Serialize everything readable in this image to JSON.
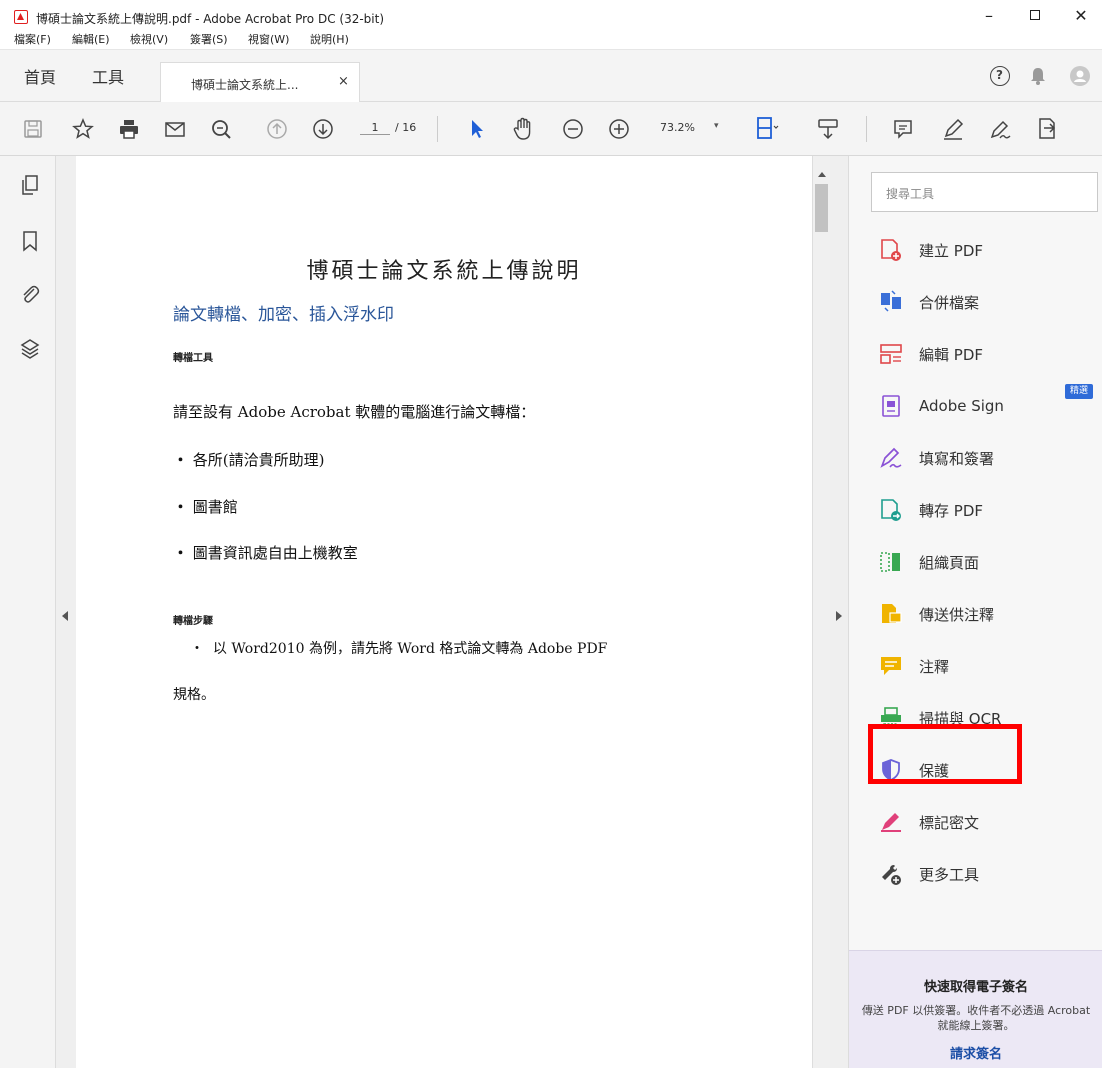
{
  "window": {
    "title": "博碩士論文系統上傳說明.pdf - Adobe Acrobat Pro DC (32-bit)",
    "minimize": "–",
    "close": "✕"
  },
  "menu": [
    "檔案(F)",
    "編輯(E)",
    "檢視(V)",
    "簽署(S)",
    "視窗(W)",
    "說明(H)"
  ],
  "tabs": {
    "home": "首頁",
    "tools": "工具",
    "document": "博碩士論文系統上...",
    "close": "×"
  },
  "toolbar": {
    "page_current": "1",
    "page_total": "/ 16",
    "zoom": "73.2%",
    "zoom_arrow": "▾"
  },
  "document": {
    "title": "博碩士論文系統上傳說明",
    "heading": "論文轉檔、加密、插入浮水印",
    "section1": "轉檔工具",
    "intro": "請至設有 Adobe Acrobat 軟體的電腦進行論文轉檔：",
    "bullet": "・",
    "bullets": [
      "各所(請洽貴所助理)",
      "圖書館",
      "圖書資訊處自由上機教室"
    ],
    "section2": "轉檔步驟",
    "step_bullet": "・",
    "step1": "以 Word2010 為例，請先將 Word 格式論文轉為 Adobe PDF",
    "step1_cont": "規格。"
  },
  "tools_pane": {
    "search_placeholder": "搜尋工具",
    "badge": "精選",
    "items": [
      {
        "label": "建立 PDF",
        "icon": "create-pdf-icon",
        "color": "#e0464a"
      },
      {
        "label": "合併檔案",
        "icon": "combine-files-icon",
        "color": "#3a6fd8"
      },
      {
        "label": "編輯 PDF",
        "icon": "edit-pdf-icon",
        "color": "#e0464a"
      },
      {
        "label": "Adobe Sign",
        "icon": "adobe-sign-icon",
        "color": "#8a52d6"
      },
      {
        "label": "填寫和簽署",
        "icon": "fill-sign-icon",
        "color": "#8a52d6"
      },
      {
        "label": "轉存 PDF",
        "icon": "export-pdf-icon",
        "color": "#1f9e8f"
      },
      {
        "label": "組織頁面",
        "icon": "organize-pages-icon",
        "color": "#39a852"
      },
      {
        "label": "傳送供注釋",
        "icon": "send-comment-icon",
        "color": "#f0b400"
      },
      {
        "label": "注釋",
        "icon": "comment-icon",
        "color": "#f0b400"
      },
      {
        "label": "掃描與 OCR",
        "icon": "scan-ocr-icon",
        "color": "#39a852"
      },
      {
        "label": "保護",
        "icon": "protect-shield-icon",
        "color": "#6b63d8"
      },
      {
        "label": "標記密文",
        "icon": "redact-icon",
        "color": "#e0407a"
      },
      {
        "label": "更多工具",
        "icon": "more-tools-icon",
        "color": "#444444"
      }
    ]
  },
  "promo": {
    "title": "快速取得電子簽名",
    "text": "傳送 PDF 以供簽署。收件者不必透過 Acrobat 就能線上簽署。",
    "link": "請求簽名"
  },
  "colors": {
    "accent": "#2f6bd8",
    "highlight": "#ff0000",
    "heading_blue": "#2a5699"
  }
}
